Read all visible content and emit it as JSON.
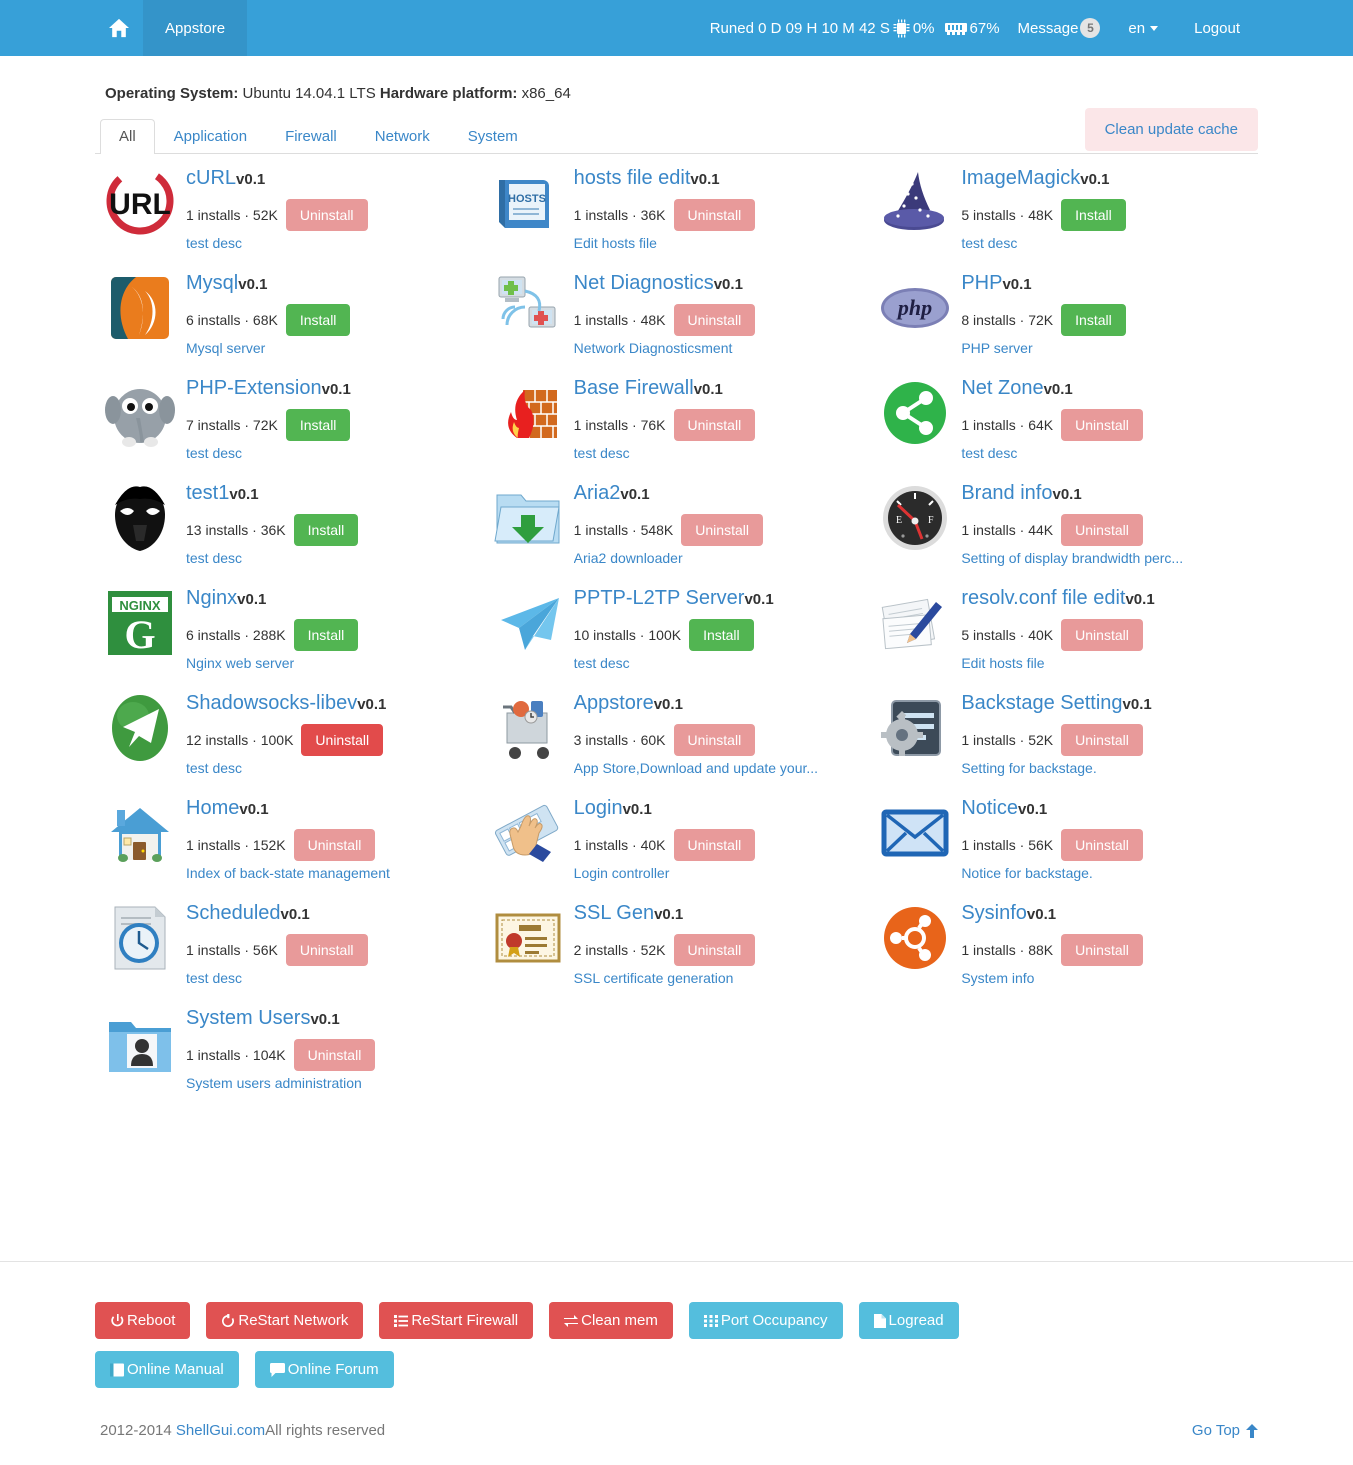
{
  "navbar": {
    "home_icon": "home-icon",
    "active_tab": "Appstore",
    "uptime": "Runed 0 D 09 H 10 M 42 S",
    "cpu_icon": "cpu-chip-icon",
    "cpu_percent": "0%",
    "ram_icon": "memory-ram-icon",
    "ram_percent": "67%",
    "message_label": "Message",
    "message_count": "5",
    "language": "en",
    "logout": "Logout"
  },
  "system": {
    "os_label": "Operating System:",
    "os_value": "Ubuntu 14.04.1 LTS",
    "hw_label": "Hardware platform:",
    "hw_value": "x86_64"
  },
  "tabs": [
    {
      "label": "All",
      "active": true
    },
    {
      "label": "Application",
      "active": false
    },
    {
      "label": "Firewall",
      "active": false
    },
    {
      "label": "Network",
      "active": false
    },
    {
      "label": "System",
      "active": false
    }
  ],
  "clean_cache_button": "Clean update cache",
  "columns": [
    [
      {
        "name": "cURL",
        "version": "v0.1",
        "installs": "1 installs",
        "size": "52K",
        "action": "Uninstall",
        "action_type": "uninstall",
        "desc": "test desc",
        "icon": "curl-logo-icon"
      },
      {
        "name": "Mysql",
        "version": "v0.1",
        "installs": "6 installs",
        "size": "68K",
        "action": "Install",
        "action_type": "install",
        "desc": "Mysql server",
        "icon": "mysql-dolphin-icon"
      },
      {
        "name": "PHP-Extension",
        "version": "v0.1",
        "installs": "7 installs",
        "size": "72K",
        "action": "Install",
        "action_type": "install",
        "desc": "test desc",
        "icon": "elephant-icon"
      },
      {
        "name": "test1",
        "version": "v0.1",
        "installs": "13 installs",
        "size": "36K",
        "action": "Install",
        "action_type": "install",
        "desc": "test desc",
        "icon": "darth-vader-icon"
      },
      {
        "name": "Nginx",
        "version": "v0.1",
        "installs": "6 installs",
        "size": "288K",
        "action": "Install",
        "action_type": "install",
        "desc": "Nginx web server",
        "icon": "nginx-logo-icon"
      },
      {
        "name": "Shadowsocks-libev",
        "version": "v0.1",
        "installs": "12 installs",
        "size": "100K",
        "action": "Uninstall",
        "action_type": "uninstall-hot",
        "desc": "test desc",
        "icon": "paper-plane-green-icon"
      },
      {
        "name": "Home",
        "version": "v0.1",
        "installs": "1 installs",
        "size": "152K",
        "action": "Uninstall",
        "action_type": "uninstall",
        "desc": "Index of back-state management",
        "icon": "house-icon"
      },
      {
        "name": "Scheduled",
        "version": "v0.1",
        "installs": "1 installs",
        "size": "56K",
        "action": "Uninstall",
        "action_type": "uninstall",
        "desc": "test desc",
        "icon": "clock-document-icon"
      },
      {
        "name": "System Users",
        "version": "v0.1",
        "installs": "1 installs",
        "size": "104K",
        "action": "Uninstall",
        "action_type": "uninstall",
        "desc": "System users administration",
        "icon": "user-folder-icon"
      }
    ],
    [
      {
        "name": "hosts file edit",
        "version": "v0.1",
        "installs": "1 installs",
        "size": "36K",
        "action": "Uninstall",
        "action_type": "uninstall",
        "desc": "Edit hosts file",
        "icon": "hosts-book-icon"
      },
      {
        "name": "Net Diagnostics",
        "version": "v0.1",
        "installs": "1 installs",
        "size": "48K",
        "action": "Uninstall",
        "action_type": "uninstall",
        "desc": "Network Diagnosticsment",
        "icon": "network-diagnostics-icon"
      },
      {
        "name": "Base Firewall",
        "version": "v0.1",
        "installs": "1 installs",
        "size": "76K",
        "action": "Uninstall",
        "action_type": "uninstall",
        "desc": "test desc",
        "icon": "firewall-flame-icon"
      },
      {
        "name": "Aria2",
        "version": "v0.1",
        "installs": "1 installs",
        "size": "548K",
        "action": "Uninstall",
        "action_type": "uninstall",
        "desc": "Aria2 downloader",
        "icon": "download-folder-icon"
      },
      {
        "name": "PPTP-L2TP Server",
        "version": "v0.1",
        "installs": "10 installs",
        "size": "100K",
        "action": "Install",
        "action_type": "install",
        "desc": "test desc",
        "icon": "paper-plane-blue-icon"
      },
      {
        "name": "Appstore",
        "version": "v0.1",
        "installs": "3 installs",
        "size": "60K",
        "action": "Uninstall",
        "action_type": "uninstall",
        "desc": "App Store,Download and update your...",
        "icon": "shopping-cart-icon"
      },
      {
        "name": "Login",
        "version": "v0.1",
        "installs": "1 installs",
        "size": "40K",
        "action": "Uninstall",
        "action_type": "uninstall",
        "desc": "Login controller",
        "icon": "keyboard-hand-icon"
      },
      {
        "name": "SSL Gen",
        "version": "v0.1",
        "installs": "2 installs",
        "size": "52K",
        "action": "Uninstall",
        "action_type": "uninstall",
        "desc": "SSL certificate generation",
        "icon": "certificate-icon"
      }
    ],
    [
      {
        "name": "ImageMagick",
        "version": "v0.1",
        "installs": "5 installs",
        "size": "48K",
        "action": "Install",
        "action_type": "install",
        "desc": "test desc",
        "icon": "wizard-hat-icon"
      },
      {
        "name": "PHP",
        "version": "v0.1",
        "installs": "8 installs",
        "size": "72K",
        "action": "Install",
        "action_type": "install",
        "desc": "PHP server",
        "icon": "php-logo-icon"
      },
      {
        "name": "Net Zone",
        "version": "v0.1",
        "installs": "1 installs",
        "size": "64K",
        "action": "Uninstall",
        "action_type": "uninstall",
        "desc": "test desc",
        "icon": "share-nodes-icon"
      },
      {
        "name": "Brand info",
        "version": "v0.1",
        "installs": "1 installs",
        "size": "44K",
        "action": "Uninstall",
        "action_type": "uninstall",
        "desc": "Setting of display brandwidth perc...",
        "icon": "gauge-meter-icon"
      },
      {
        "name": "resolv.conf file edit",
        "version": "v0.1",
        "installs": "5 installs",
        "size": "40K",
        "action": "Uninstall",
        "action_type": "uninstall",
        "desc": "Edit hosts file",
        "icon": "document-pen-icon"
      },
      {
        "name": "Backstage Setting",
        "version": "v0.1",
        "installs": "1 installs",
        "size": "52K",
        "action": "Uninstall",
        "action_type": "uninstall",
        "desc": "Setting for backstage.",
        "icon": "gear-settings-icon"
      },
      {
        "name": "Notice",
        "version": "v0.1",
        "installs": "1 installs",
        "size": "56K",
        "action": "Uninstall",
        "action_type": "uninstall",
        "desc": "Notice for backstage.",
        "icon": "envelope-icon"
      },
      {
        "name": "Sysinfo",
        "version": "v0.1",
        "installs": "1 installs",
        "size": "88K",
        "action": "Uninstall",
        "action_type": "uninstall",
        "desc": "System info",
        "icon": "ubuntu-logo-icon"
      }
    ]
  ],
  "footer": {
    "buttons": [
      {
        "label": "Reboot",
        "color": "red",
        "icon": "power-icon"
      },
      {
        "label": "ReStart Network",
        "color": "red",
        "icon": "refresh-icon"
      },
      {
        "label": "ReStart Firewall",
        "color": "red",
        "icon": "list-icon"
      },
      {
        "label": "Clean mem",
        "color": "red",
        "icon": "exchange-icon"
      },
      {
        "label": "Port Occupancy",
        "color": "cyan",
        "icon": "grid-icon"
      },
      {
        "label": "Logread",
        "color": "cyan",
        "icon": "file-icon"
      },
      {
        "label": "Online Manual",
        "color": "cyan",
        "icon": "book-icon"
      },
      {
        "label": "Online Forum",
        "color": "cyan",
        "icon": "comment-icon"
      }
    ],
    "copyright_years": "2012-2014 ",
    "copyright_link": "ShellGui.com",
    "copyright_rest": "All rights reserved",
    "go_top": "Go Top"
  },
  "colors": {
    "navbar": "#37a0d8",
    "install": "#52b552",
    "uninstall": "#e89a9a",
    "uninstall_hot": "#e24b4b",
    "link": "#3a87c8",
    "footer_red": "#e05252",
    "footer_cyan": "#54bedd"
  }
}
